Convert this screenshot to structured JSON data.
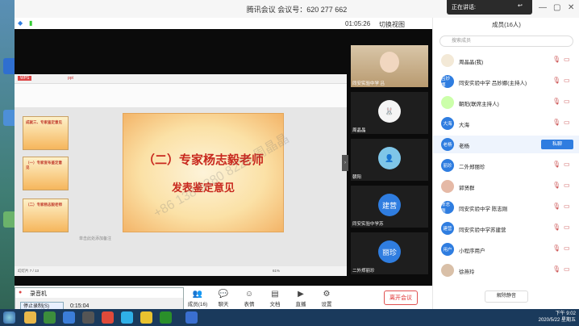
{
  "meeting": {
    "title": "腾讯会议 会议号：620 277 662",
    "timer": "01:05:26",
    "switch_view": "切换视图",
    "speaking_label": "正在讲话:"
  },
  "slides": {
    "thumbs": [
      "成就三、专家鉴定意见",
      "（一）专家宣布鉴定意见",
      "（二）专家杨志毅老师"
    ],
    "main_line1": "（二）专家杨志毅老师",
    "main_line2": "发表鉴定意见",
    "watermark": "+86 138 6380 8226 周晶晶",
    "tab_label": "ppt",
    "status_left": "幻灯片 7 / 13",
    "zoom": "61%",
    "notes": "单击此处添加备注"
  },
  "videos": [
    {
      "label": "同安实验中学 吕"
    },
    {
      "label": "周晶晶"
    },
    {
      "label": "朝阳"
    },
    {
      "label": "同安实验中学苏"
    },
    {
      "label": "二外郑丽珍"
    }
  ],
  "tile_avatars": [
    "建营",
    "丽珍"
  ],
  "toolbar": {
    "members": "成员(16)",
    "chat": "聊天",
    "reactions": "表情",
    "docs": "文档",
    "live": "直播",
    "settings": "设置",
    "leave": "离开会议"
  },
  "panel": {
    "title": "成员(16人)",
    "search_placeholder": "搜索成员",
    "unmute_all": "解除静音",
    "raise_hand": "私聊"
  },
  "members": [
    {
      "avatar": "",
      "name": "周晶晶(我)"
    },
    {
      "avatar": "吕妙娜",
      "name": "同安实验中学 吕妙娜(主持人)"
    },
    {
      "avatar": "",
      "name": "朝阳(联席主持人)"
    },
    {
      "avatar": "大海",
      "name": "大海"
    },
    {
      "avatar": "老杨",
      "name": "老杨"
    },
    {
      "avatar": "丽珍",
      "name": "二外郑丽珍"
    },
    {
      "avatar": "",
      "name": "郭贤群"
    },
    {
      "avatar": "陈志刚",
      "name": "同安实验中学 陈志刚"
    },
    {
      "avatar": "建营",
      "name": "同安实验中学苏建营"
    },
    {
      "avatar": "用户",
      "name": "小程序用户"
    },
    {
      "avatar": "",
      "name": "徐燕玲"
    }
  ],
  "recorder": {
    "title": "录音机",
    "action": "停止录制(S)",
    "time": "0:15:04"
  },
  "clock": {
    "time": "下午 9:02",
    "date": "2020/5/22 星期五"
  }
}
